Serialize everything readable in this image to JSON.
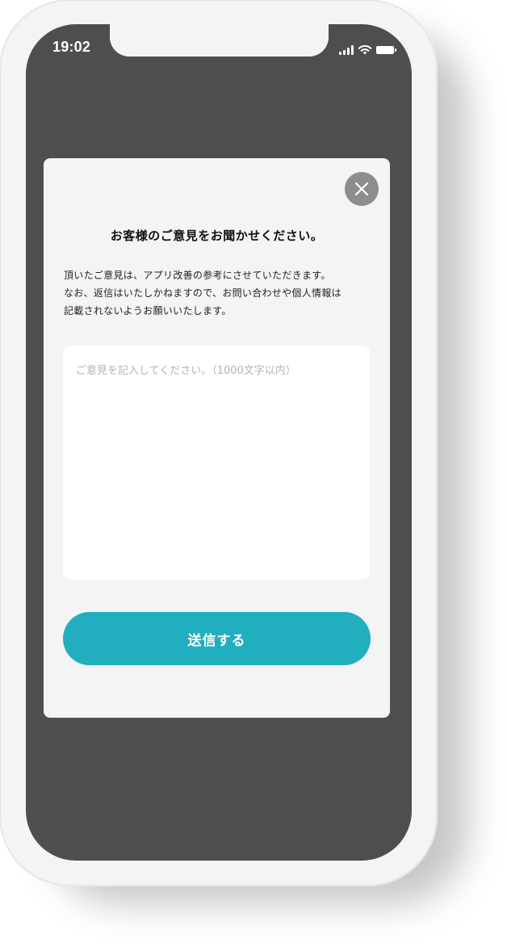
{
  "status_bar": {
    "time": "19:02",
    "icons": [
      "cellular-signal-icon",
      "wifi-icon",
      "battery-icon"
    ]
  },
  "modal": {
    "close_icon": "close-icon",
    "title": "お客様のご意見をお聞かせください。",
    "description": [
      "頂いたご意見は、アプリ改善の参考にさせていただきます。",
      "なお、返信はいたしかねますので、お問い合わせや個人情報は",
      "記載されないようお願いいたします。"
    ],
    "feedback_input": {
      "value": "",
      "placeholder": "ご意見を記入してください。（1000文字以内）"
    },
    "submit_label": "送信する"
  },
  "colors": {
    "overlay": "#4e4e4e",
    "modal_bg": "#f4f4f4",
    "accent": "#21aebf",
    "close_button": "#8d8d8d"
  }
}
